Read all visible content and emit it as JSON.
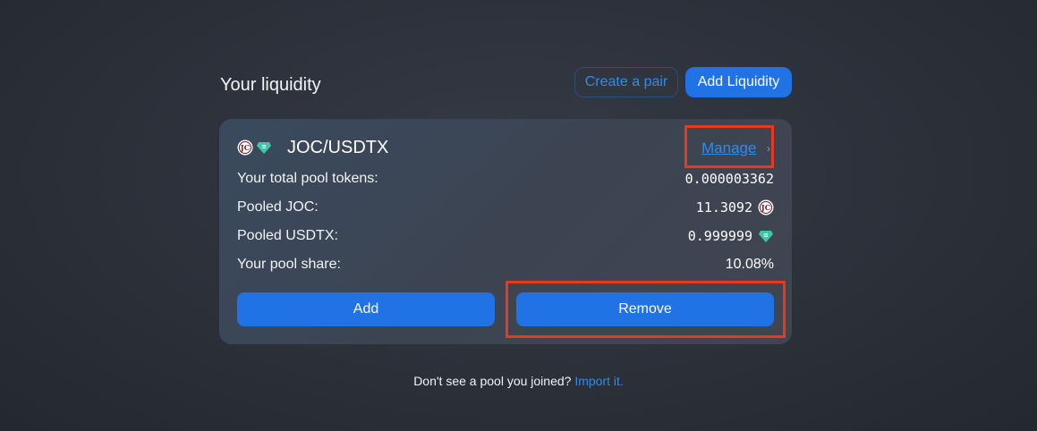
{
  "header": {
    "title": "Your liquidity",
    "create_pair_label": "Create a pair",
    "add_liquidity_label": "Add Liquidity"
  },
  "pool": {
    "pair": "JOC/USDTX",
    "manage_label": "Manage",
    "token_a_icon": "joc-token-icon",
    "token_b_icon": "usdtx-token-icon",
    "rows": [
      {
        "label": "Your total pool tokens:",
        "value": "0.000003362"
      },
      {
        "label": "Pooled JOC:",
        "value": "11.3092"
      },
      {
        "label": "Pooled USDTX:",
        "value": "0.999999"
      },
      {
        "label": "Your pool share:",
        "value": "10.08%"
      }
    ],
    "add_label": "Add",
    "remove_label": "Remove"
  },
  "footer": {
    "text": "Don't see a pool you joined?",
    "link": "Import it."
  },
  "colors": {
    "accent": "#2172e5",
    "link": "#2d8cf0",
    "highlight": "#e8391d",
    "usdtx_icon": "#3ec6a8"
  }
}
